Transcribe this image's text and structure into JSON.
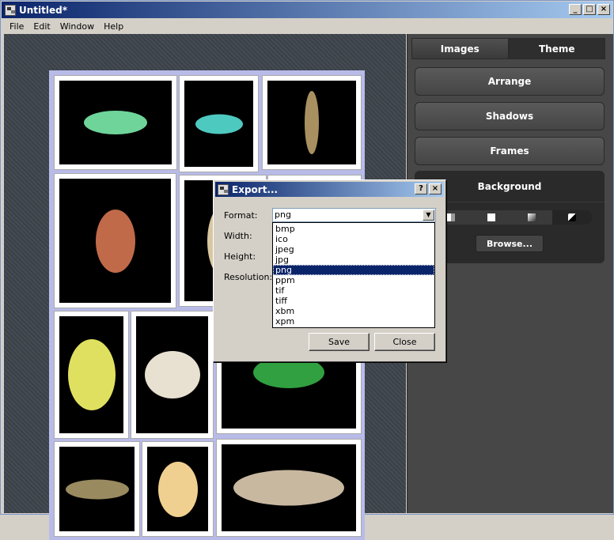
{
  "window": {
    "title": "Untitled*",
    "controls": [
      "_",
      "□",
      "×"
    ]
  },
  "menu": [
    "File",
    "Edit",
    "Window",
    "Help"
  ],
  "panel": {
    "tabs": [
      "Images",
      "Theme"
    ],
    "selected_tab": "Theme",
    "buttons": [
      "Arrange",
      "Shadows",
      "Frames"
    ],
    "background": {
      "title": "Background",
      "browse_label": "Browse..."
    }
  },
  "dialog": {
    "title": "Export...",
    "help": "?",
    "close": "×",
    "labels": {
      "format": "Format:",
      "width": "Width:",
      "height": "Height:",
      "resolution": "Resolution:"
    },
    "format_value": "png",
    "format_options": [
      "bmp",
      "ico",
      "jpeg",
      "jpg",
      "png",
      "ppm",
      "tif",
      "tiff",
      "xbm",
      "xpm"
    ],
    "save_label": "Save",
    "close_label": "Close"
  },
  "colors": {
    "titlebar": "#0a246a",
    "panel": "#474747",
    "selection": "#0a246a"
  }
}
